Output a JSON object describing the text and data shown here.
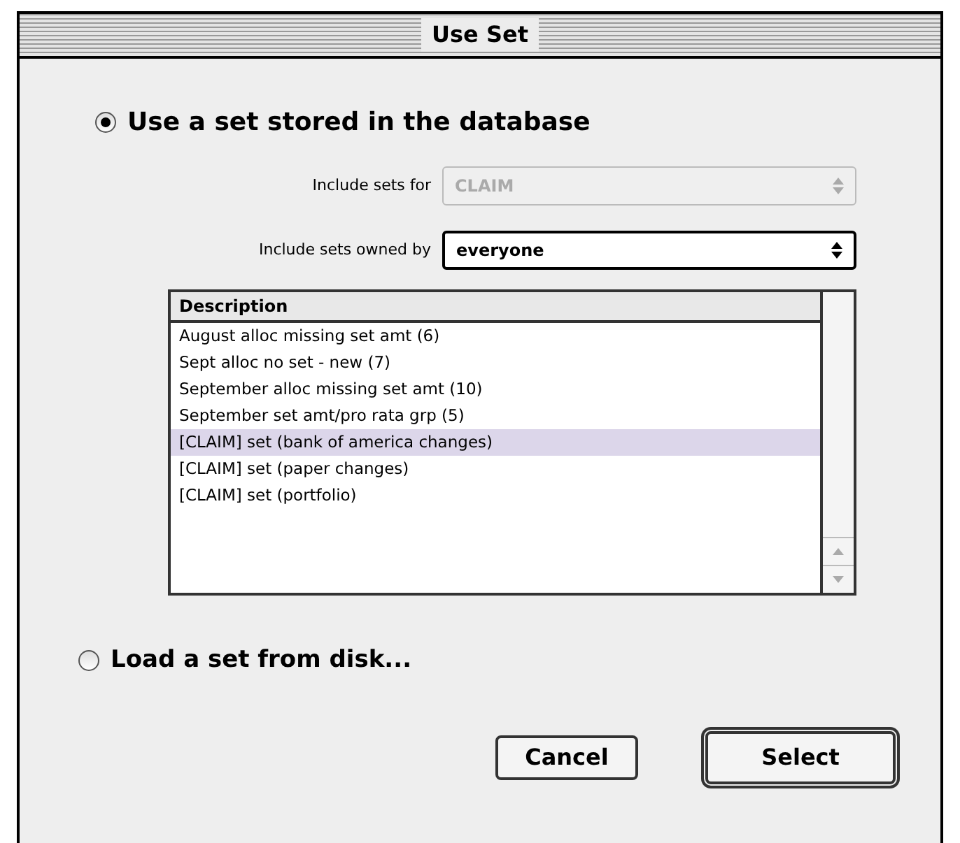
{
  "window": {
    "title": "Use Set"
  },
  "options": [
    {
      "label": "Use a set stored in the database",
      "selected": true
    },
    {
      "label": "Load a set from disk...",
      "selected": false
    }
  ],
  "fields": [
    {
      "label": "Include sets for",
      "value": "CLAIM",
      "disabled": true
    },
    {
      "label": "Include sets owned by",
      "value": "everyone",
      "disabled": false
    }
  ],
  "list": {
    "column": "Description",
    "rows": [
      {
        "text": "August alloc missing set amt (6)",
        "selected": false
      },
      {
        "text": "Sept alloc no set - new (7)",
        "selected": false
      },
      {
        "text": "September alloc missing set amt (10)",
        "selected": false
      },
      {
        "text": "September set amt/pro rata grp (5)",
        "selected": false
      },
      {
        "text": "[CLAIM] set (bank of america changes)",
        "selected": true
      },
      {
        "text": "[CLAIM] set (paper changes)",
        "selected": false
      },
      {
        "text": "[CLAIM] set (portfolio)",
        "selected": false
      }
    ]
  },
  "buttons": [
    {
      "label": "Cancel",
      "default": false
    },
    {
      "label": "Select",
      "default": true
    }
  ]
}
